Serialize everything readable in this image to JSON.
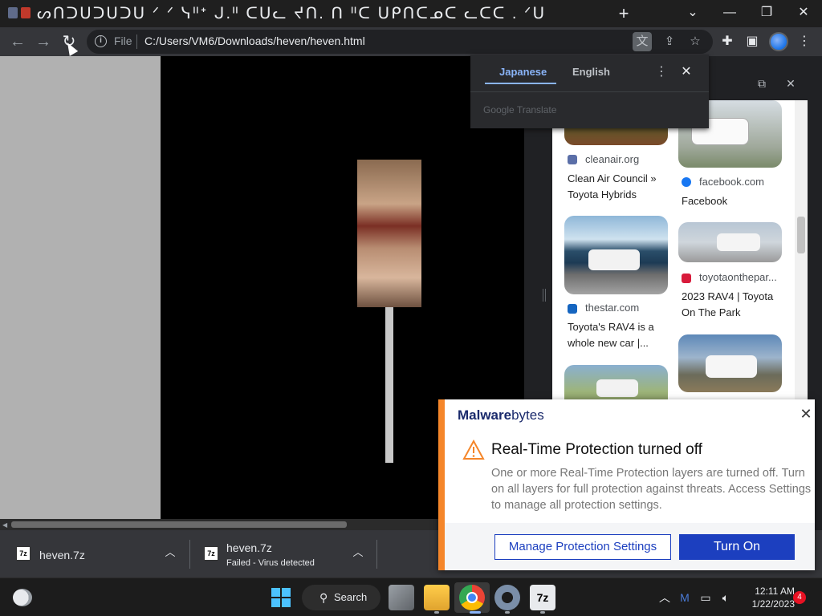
{
  "browser": {
    "tab_title": "ᔕᑎᑐᑌᑐᑌᑐᑌ ᐟ ᐟ ᓭᐦᐩ ᒍ.ᐦ ᑕᑌᓚ ᔪᑎ. ᑎ ᐦᑕ ᑌᑭᑎᑕᓄᑕ ᓚᑕᑕ . ᐟᑌ",
    "new_tab_label": "+",
    "address": {
      "scheme_label": "File",
      "url": "C:/Users/VM6/Downloads/heven/heven.html"
    }
  },
  "translate_popup": {
    "tab_source": "Japanese",
    "tab_target": "English",
    "brand": "Google Translate"
  },
  "side_panel": {
    "results": [
      {
        "source": "cleanair.org",
        "title": "Clean Air Council » Toyota Hybrids"
      },
      {
        "source": "facebook.com",
        "title": "Facebook"
      },
      {
        "source": "thestar.com",
        "title": "Toyota's RAV4 is a whole new car |..."
      },
      {
        "source": "toyotaonthepar...",
        "title": "2023 RAV4 | Toyota On The Park"
      }
    ]
  },
  "downloads": [
    {
      "name": "heven.7z",
      "status": ""
    },
    {
      "name": "heven.7z",
      "status": "Failed - Virus detected"
    }
  ],
  "malwarebytes": {
    "logo_bold": "Malware",
    "logo_rest": "bytes",
    "title": "Real-Time Protection turned off",
    "body": "One or more Real-Time Protection layers are turned off. Turn on all layers for full protection against threats. Access Settings to manage all protection settings.",
    "secondary_button": "Manage Protection Settings",
    "primary_button": "Turn On"
  },
  "taskbar": {
    "search_label": "Search",
    "time": "12:11 AM",
    "date": "1/22/2023",
    "notification_count": "4"
  },
  "colors": {
    "malwarebytes_accent": "#f5862a",
    "malwarebytes_blue": "#1c3fbf",
    "translate_accent": "#8ab4f8"
  }
}
